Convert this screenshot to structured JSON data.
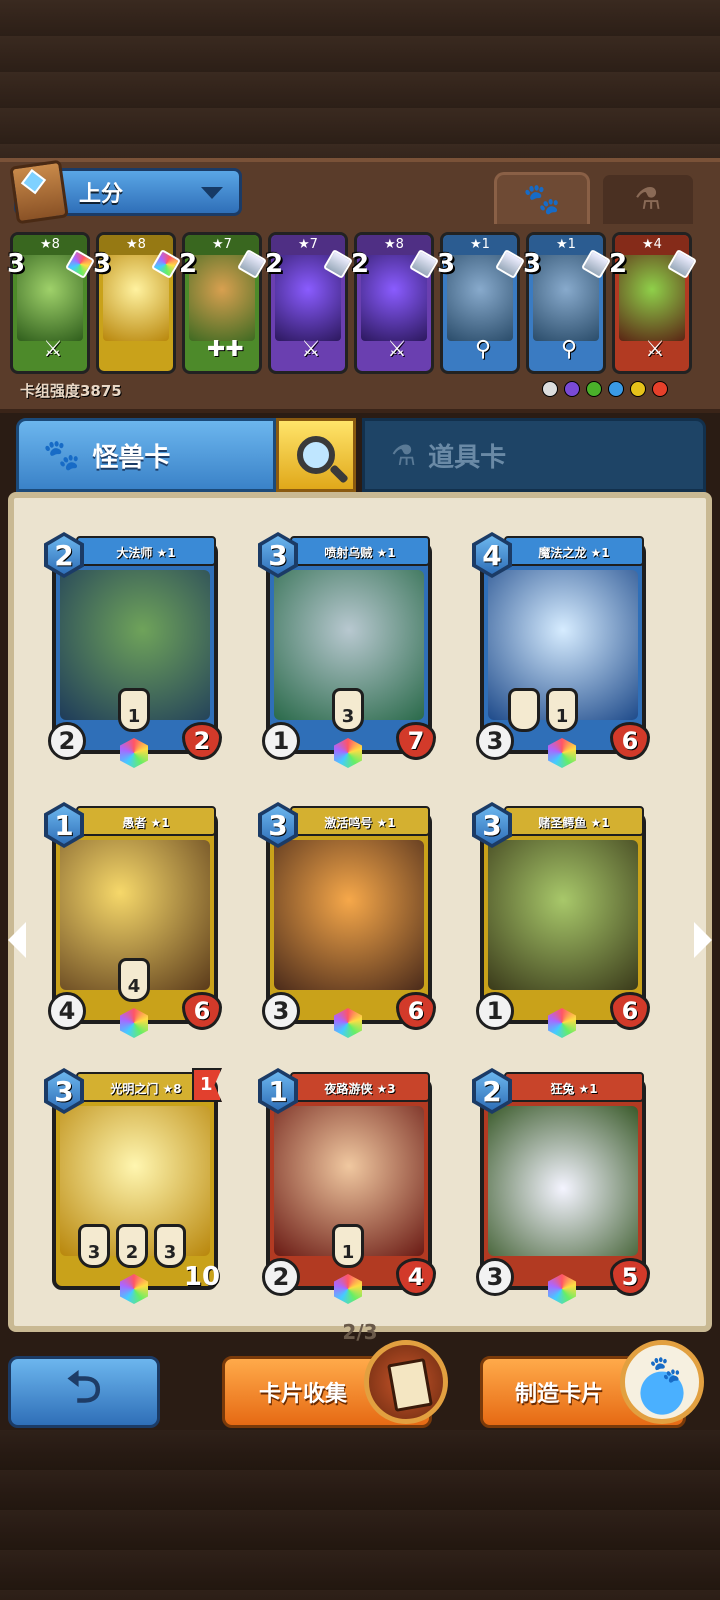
{
  "deck": {
    "selected_name": "上分",
    "power_text": "卡组强度3875",
    "mini_cards": [
      {
        "stars": "★8",
        "cost": "3",
        "color": "green"
      },
      {
        "stars": "★8",
        "cost": "3",
        "color": "gold"
      },
      {
        "stars": "★7",
        "cost": "2",
        "color": "green"
      },
      {
        "stars": "★7",
        "cost": "2",
        "color": "purple"
      },
      {
        "stars": "★8",
        "cost": "2",
        "color": "purple"
      },
      {
        "stars": "★1",
        "cost": "3",
        "color": "blue"
      },
      {
        "stars": "★1",
        "cost": "3",
        "color": "blue"
      },
      {
        "stars": "★4",
        "cost": "2",
        "color": "red"
      }
    ]
  },
  "tabs": {
    "monster_label": "怪兽卡",
    "item_label": "道具卡"
  },
  "cards": [
    {
      "name": "大法师 ★1",
      "cost": "2",
      "atk": "2",
      "hp": "2",
      "frame": "blue",
      "abilities": [
        "1"
      ]
    },
    {
      "name": "喷射乌贼 ★1",
      "cost": "3",
      "atk": "1",
      "hp": "7",
      "frame": "blue",
      "abilities": [
        "3"
      ]
    },
    {
      "name": "魔法之龙 ★1",
      "cost": "4",
      "atk": "3",
      "hp": "6",
      "frame": "blue",
      "abilities": [
        "",
        "1"
      ]
    },
    {
      "name": "愚者 ★1",
      "cost": "1",
      "atk": "4",
      "hp": "6",
      "frame": "gold",
      "abilities": [
        "4"
      ]
    },
    {
      "name": "激活鸣号 ★1",
      "cost": "3",
      "atk": "3",
      "hp": "6",
      "frame": "gold",
      "abilities": []
    },
    {
      "name": "赌圣鳄鱼 ★1",
      "cost": "3",
      "atk": "1",
      "hp": "6",
      "frame": "gold",
      "abilities": []
    },
    {
      "name": "光明之门 ★8",
      "cost": "3",
      "atk": "",
      "hp": "10",
      "frame": "gold",
      "abilities": [
        "3",
        "2",
        "3"
      ],
      "flag": "1"
    },
    {
      "name": "夜路游侠 ★3",
      "cost": "1",
      "atk": "2",
      "hp": "4",
      "frame": "red",
      "abilities": [
        "1"
      ]
    },
    {
      "name": "狂兔 ★1",
      "cost": "2",
      "atk": "3",
      "hp": "5",
      "frame": "red",
      "abilities": []
    }
  ],
  "pager": {
    "text": "2/3"
  },
  "buttons": {
    "collect_label": "卡片收集",
    "craft_label": "制造卡片"
  }
}
